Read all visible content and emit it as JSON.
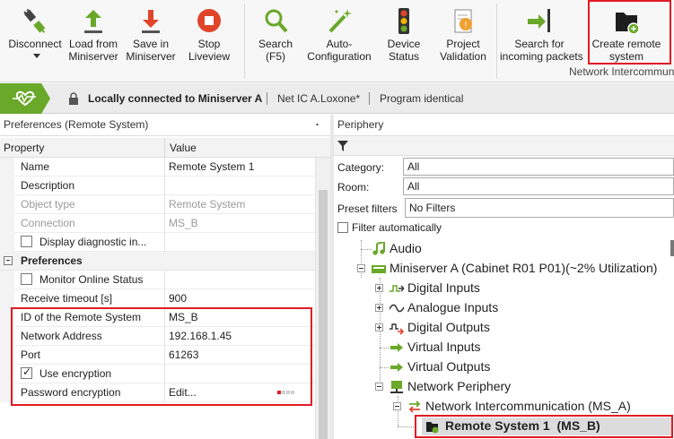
{
  "ribbon": {
    "buttons": [
      {
        "line1": "Disconnect",
        "line2": "",
        "icon": "plug-disconnect-icon"
      },
      {
        "line1": "Load from",
        "line2": "Miniserver",
        "icon": "upload-arrow-icon"
      },
      {
        "line1": "Save in",
        "line2": "Miniserver",
        "icon": "download-arrow-icon"
      },
      {
        "line1": "Stop",
        "line2": "Liveview",
        "icon": "stop-icon"
      },
      {
        "line1": "Search",
        "line2": "(F5)",
        "icon": "search-icon"
      },
      {
        "line1": "Auto-",
        "line2": "Configuration",
        "icon": "magic-wand-icon"
      },
      {
        "line1": "Device",
        "line2": "Status",
        "icon": "traffic-light-icon"
      },
      {
        "line1": "Project",
        "line2": "Validation",
        "icon": "validation-icon"
      },
      {
        "line1": "Search for",
        "line2": "incoming packets",
        "icon": "incoming-packets-icon"
      },
      {
        "line1": "Create remote",
        "line2": "system",
        "icon": "create-remote-system-icon"
      }
    ],
    "group_label": "Network Intercommunic"
  },
  "status": {
    "connection": "Locally connected to Miniserver A",
    "project": "Net IC A.Loxone*",
    "program": "Program identical"
  },
  "preferences": {
    "title": "Preferences (Remote System)",
    "pin": "⬝",
    "col_property": "Property",
    "col_value": "Value",
    "rows": [
      {
        "key": "Name",
        "value": "Remote System 1"
      },
      {
        "key": "Description",
        "value": ""
      },
      {
        "key": "Object type",
        "value": "Remote System"
      },
      {
        "key": "Connection",
        "value": "MS_B"
      },
      {
        "key": "Display diagnostic in...",
        "value": ""
      }
    ],
    "section": "Preferences",
    "rows2": [
      {
        "key": "Monitor Online Status",
        "value": ""
      },
      {
        "key": "Receive timeout [s]",
        "value": "900"
      },
      {
        "key": "ID of the Remote System",
        "value": "MS_B"
      },
      {
        "key": "Network Address",
        "value": "192.168.1.45"
      },
      {
        "key": "Port",
        "value": "61263"
      },
      {
        "key": "Use encryption",
        "value": ""
      },
      {
        "key": "Password encryption",
        "value": "Edit..."
      }
    ]
  },
  "periphery": {
    "title": "Periphery",
    "category_label": "Category:",
    "category_value": "All",
    "room_label": "Room:",
    "room_value": "All",
    "preset_label": "Preset filters",
    "preset_value": "No Filters",
    "filter_auto": "Filter automatically",
    "tree": [
      {
        "label": "Audio",
        "icon": "music-note-icon"
      },
      {
        "label": "Miniserver A (Cabinet R01 P01)(~2% Utilization)",
        "icon": "miniserver-icon"
      },
      {
        "label": "Digital Inputs",
        "icon": "digital-inputs-icon"
      },
      {
        "label": "Analogue Inputs",
        "icon": "analogue-inputs-icon"
      },
      {
        "label": "Digital Outputs",
        "icon": "digital-outputs-icon"
      },
      {
        "label": "Virtual Inputs",
        "icon": "virtual-inputs-icon"
      },
      {
        "label": "Virtual Outputs",
        "icon": "virtual-outputs-icon"
      },
      {
        "label": "Network Periphery",
        "icon": "network-periphery-icon"
      },
      {
        "label": "Network Intercommunication (MS_A)",
        "icon": "intercommunication-icon"
      },
      {
        "label": "Remote System 1  (MS_B)",
        "icon": "remote-system-icon"
      }
    ]
  },
  "colors": {
    "accent_green": "#69a829",
    "highlight_red": "#e01b24"
  }
}
